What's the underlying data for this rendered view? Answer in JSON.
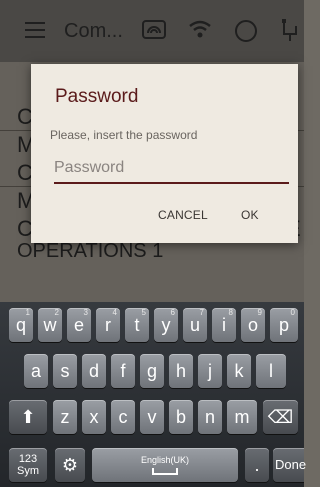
{
  "app_bar": {
    "title": "Com...",
    "icons": [
      "menu-icon",
      "cast-icon",
      "wifi-icon",
      "circle-icon",
      "usb-icon"
    ]
  },
  "background_rows": [
    {
      "text": "C"
    },
    {
      "text": "M"
    },
    {
      "text": "C"
    },
    {
      "text": "M"
    },
    {
      "text": "C"
    },
    {
      "text": "OPERATIONS 1"
    }
  ],
  "background_row_end": "E",
  "dialog": {
    "title": "Password",
    "message": "Please, insert the password",
    "input_placeholder": "Password",
    "input_value": "",
    "cancel_label": "CANCEL",
    "ok_label": "OK"
  },
  "keyboard": {
    "row1": [
      {
        "key": "q",
        "hint": "1"
      },
      {
        "key": "w",
        "hint": "2"
      },
      {
        "key": "e",
        "hint": "3"
      },
      {
        "key": "r",
        "hint": "4"
      },
      {
        "key": "t",
        "hint": "5"
      },
      {
        "key": "y",
        "hint": "6"
      },
      {
        "key": "u",
        "hint": "7"
      },
      {
        "key": "i",
        "hint": "8"
      },
      {
        "key": "o",
        "hint": "9"
      },
      {
        "key": "p",
        "hint": "0"
      }
    ],
    "row2": [
      "a",
      "s",
      "d",
      "f",
      "g",
      "h",
      "j",
      "k",
      "l"
    ],
    "row3": [
      "z",
      "x",
      "c",
      "v",
      "b",
      "n",
      "m"
    ],
    "shift_label": "⬆",
    "delete_label": "⌫",
    "sym_label": "123\nSym",
    "settings_label": "⚙",
    "space_label": "English(UK)",
    "period_label": ".",
    "done_label": "Done"
  }
}
